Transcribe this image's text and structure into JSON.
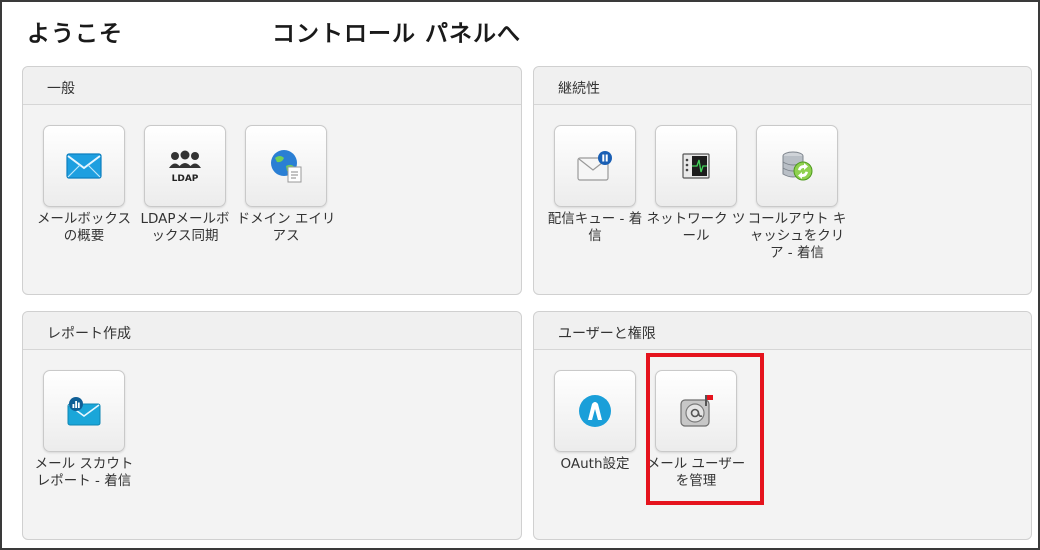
{
  "header": {
    "title_left": "ようこそ",
    "title_right": "コントロール パネルへ"
  },
  "panels": {
    "general": {
      "title": "一般",
      "tiles": [
        {
          "label": "メールボックスの概要",
          "icon": "envelope-icon"
        },
        {
          "label": "LDAPメールボックス同期",
          "icon": "ldap-users-icon"
        },
        {
          "label": "ドメイン エイリアス",
          "icon": "globe-document-icon"
        }
      ]
    },
    "continuity": {
      "title": "継続性",
      "tiles": [
        {
          "label": "配信キュー - 着信",
          "icon": "mail-pause-icon"
        },
        {
          "label": "ネットワーク ツール",
          "icon": "network-tool-icon"
        },
        {
          "label": "コールアウト キャッシュをクリア - 着信",
          "icon": "database-refresh-icon"
        }
      ]
    },
    "reports": {
      "title": "レポート作成",
      "tiles": [
        {
          "label": "メール スカウト レポート - 着信",
          "icon": "mail-report-icon"
        }
      ]
    },
    "users": {
      "title": "ユーザーと権限",
      "tiles": [
        {
          "label": "OAuth設定",
          "icon": "oauth-icon"
        },
        {
          "label": "メール ユーザーを管理",
          "icon": "mail-user-manage-icon"
        }
      ]
    }
  },
  "colors": {
    "highlight": "#e5131d",
    "accent_blue": "#1a9fd9"
  }
}
